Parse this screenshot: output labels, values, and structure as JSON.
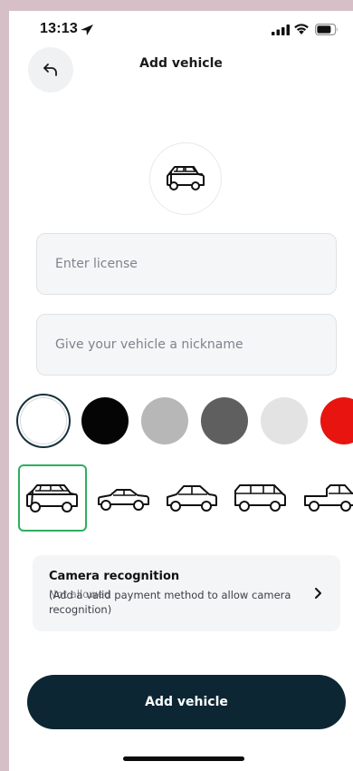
{
  "status_bar": {
    "time": "13:13",
    "icons": [
      "location-arrow-icon",
      "signal-icon",
      "wifi-icon",
      "battery-icon"
    ]
  },
  "header": {
    "back_icon": "back-arrow-icon",
    "title": "Add vehicle"
  },
  "vehicle_avatar": {
    "icon": "suv-icon"
  },
  "form": {
    "license": {
      "placeholder": "Enter license",
      "value": ""
    },
    "nickname": {
      "placeholder": "Give your vehicle a nickname",
      "value": ""
    }
  },
  "colors": [
    {
      "name": "white",
      "hex": "#ffffff",
      "selected": true
    },
    {
      "name": "black",
      "hex": "#050505",
      "selected": false
    },
    {
      "name": "silver",
      "hex": "#b7b7b7",
      "selected": false
    },
    {
      "name": "dark-gray",
      "hex": "#5f5f5f",
      "selected": false
    },
    {
      "name": "light-gray",
      "hex": "#e3e3e3",
      "selected": false
    },
    {
      "name": "red",
      "hex": "#e8140f",
      "selected": false
    }
  ],
  "vehicle_types": [
    {
      "name": "suv",
      "icon": "suv-icon",
      "selected": true
    },
    {
      "name": "sedan",
      "icon": "sedan-icon",
      "selected": false
    },
    {
      "name": "hatchback",
      "icon": "hatchback-icon",
      "selected": false
    },
    {
      "name": "van",
      "icon": "van-icon",
      "selected": false
    },
    {
      "name": "pickup",
      "icon": "pickup-icon",
      "selected": false
    }
  ],
  "camera_recognition": {
    "title": "Camera recognition",
    "overlay_status": "Not allowed",
    "description": "(Add a valid payment method to allow camera recognition)",
    "chevron_icon": "chevron-right-icon"
  },
  "actions": {
    "add_vehicle_label": "Add vehicle"
  },
  "theme": {
    "accent": "#0d2633",
    "selected_border": "#2bb05f"
  }
}
